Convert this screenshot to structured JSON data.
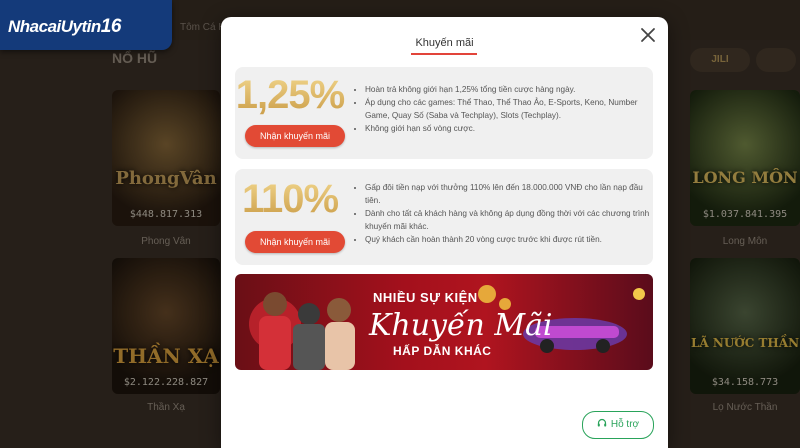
{
  "brand": {
    "name": "NhacaiUytin",
    "number": "16"
  },
  "background": {
    "section_title": "NỔ HŨ",
    "top_label": "Tôm Cá Hũ",
    "chip_right": "JILI",
    "games": [
      {
        "art_title": "PhongVân",
        "jackpot": "$448.817.313",
        "caption": "Phong Vân"
      },
      {
        "art_title": "LONG MÔN",
        "jackpot": "$1.037.841.395",
        "caption": "Long Môn"
      },
      {
        "art_title": "THẦN XẠ",
        "jackpot": "$2.122.228.827",
        "caption": "Thần Xạ"
      },
      {
        "art_title": "LÃ NƯỚC THẦN",
        "jackpot": "$34.158.773",
        "caption": "Lọ Nước Thần"
      }
    ]
  },
  "modal": {
    "tab_label": "Khuyến mãi",
    "promos": [
      {
        "headline": "1,25%",
        "cta": "Nhận khuyến mãi",
        "bullets": [
          "Hoàn trả không giới hạn 1,25% tổng tiền cược hàng ngày.",
          "Áp dụng cho các games: Thể Thao, Thể Thao Ảo, E-Sports, Keno, Number Game, Quay Số (Saba và Techplay), Slots (Techplay).",
          "Không giới hạn số vòng cược."
        ]
      },
      {
        "headline": "110%",
        "cta": "Nhận khuyến mãi",
        "bullets": [
          "Gấp đôi tiền nạp với thưởng 110% lên đến 18.000.000 VNĐ cho lần nạp đầu tiên.",
          "Dành cho tất cả khách hàng và không áp dụng đồng thời với các chương trình khuyến mãi khác.",
          "Quý khách cần hoàn thành 20 vòng cược trước khi được rút tiền."
        ]
      }
    ],
    "banner": {
      "line1": "NHIỀU SỰ KIỆN",
      "line2": "Khuyến Mãi",
      "line3": "HẤP DẪN KHÁC"
    },
    "support_label": "Hỗ trợ"
  },
  "colors": {
    "accent": "#e24a35",
    "gold": "#d8b368",
    "support": "#29a35a"
  },
  "icons": [
    "close-icon",
    "headset-icon"
  ]
}
